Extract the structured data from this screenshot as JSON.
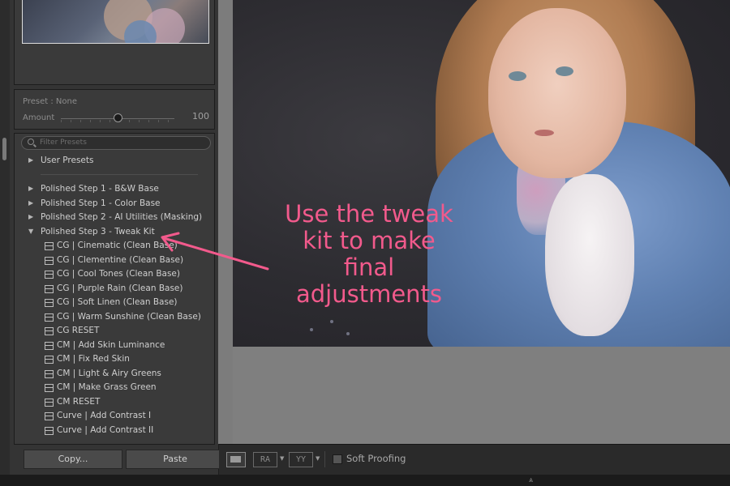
{
  "preset_panel": {
    "preset_text": "Preset : None",
    "amount_label": "Amount",
    "amount_value": "100"
  },
  "presets": {
    "filter_placeholder": "Filter Presets",
    "user_presets": "User Presets",
    "folders": [
      "Polished Step 1 - B&W Base",
      "Polished Step 1 - Color Base",
      "Polished Step 2 - AI Utilities (Masking)",
      "Polished Step 3 - Tweak Kit"
    ],
    "tweak_kit_items": [
      "CG | Cinematic (Clean Base)",
      "CG | Clementine (Clean Base)",
      "CG | Cool Tones (Clean Base)",
      "CG | Purple Rain (Clean Base)",
      "CG | Soft Linen (Clean Base)",
      "CG | Warm Sunshine (Clean Base)",
      "CG RESET",
      "CM | Add Skin Luminance",
      "CM | Fix Red Skin",
      "CM | Light & Airy Greens",
      "CM | Make Grass Green",
      "CM RESET",
      "Curve | Add Contrast I",
      "Curve | Add Contrast II"
    ]
  },
  "buttons": {
    "copy": "Copy...",
    "paste": "Paste"
  },
  "toolbar": {
    "ra": "RA",
    "yy": "YY",
    "soft_proofing": "Soft Proofing"
  },
  "annotation": {
    "line1": "Use the tweak",
    "line2": "kit to make",
    "line3": "final",
    "line4": "adjustments",
    "color": "#f25a8c"
  }
}
